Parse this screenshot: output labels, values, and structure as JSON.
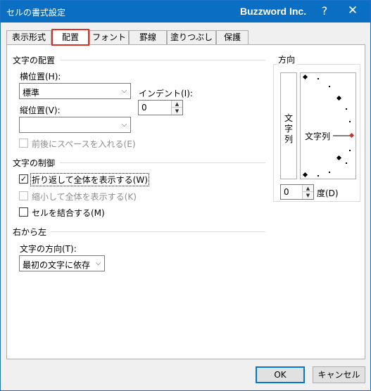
{
  "window": {
    "title": "セルの書式設定",
    "brand": "Buzzword Inc.",
    "help_glyph": "?",
    "close_glyph": "✕"
  },
  "tabs": [
    {
      "label": "表示形式",
      "active": false
    },
    {
      "label": "配置",
      "active": true
    },
    {
      "label": "フォント",
      "active": false
    },
    {
      "label": "罫線",
      "active": false
    },
    {
      "label": "塗りつぶし",
      "active": false
    },
    {
      "label": "保護",
      "active": false
    }
  ],
  "text_alignment": {
    "heading": "文字の配置",
    "horizontal_label": "横位置(H):",
    "horizontal_value": "標準",
    "vertical_label": "縦位置(V):",
    "vertical_value": "",
    "indent_label": "インデント(I):",
    "indent_value": "0",
    "justify_distributed_label": "前後にスペースを入れる(E)",
    "justify_distributed_checked": false
  },
  "text_control": {
    "heading": "文字の制御",
    "wrap_text_label": "折り返して全体を表示する(W)",
    "wrap_text_checked": true,
    "shrink_to_fit_label": "縮小して全体を表示する(K)",
    "shrink_to_fit_checked": false,
    "merge_cells_label": "セルを結合する(M)",
    "merge_cells_checked": false
  },
  "right_to_left": {
    "heading": "右から左",
    "direction_label": "文字の方向(T):",
    "direction_value": "最初の文字に依存"
  },
  "orientation": {
    "heading": "方向",
    "vertical_text": [
      "文",
      "字",
      "列"
    ],
    "dial_text": "文字列",
    "degrees_value": "0",
    "degrees_label": "度(D)"
  },
  "buttons": {
    "ok": "OK",
    "cancel": "キャンセル"
  },
  "colors": {
    "titlebar": "#0a6fc2",
    "active_tab_border": "#e0302a",
    "dial_marker": "#c0392b",
    "default_button_border": "#0078d7"
  }
}
